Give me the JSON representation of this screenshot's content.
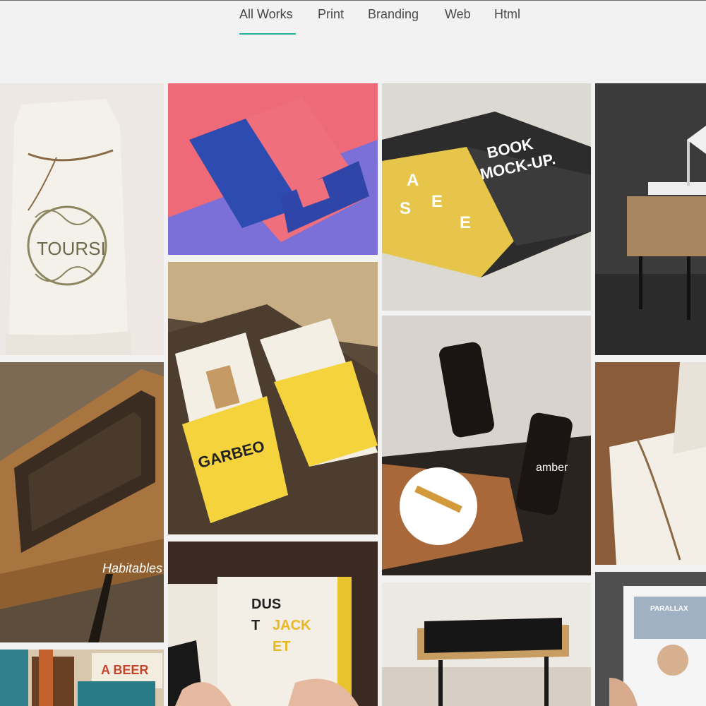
{
  "filters": {
    "all_works": "All Works",
    "print": "Print",
    "branding": "Branding",
    "web": "Web",
    "html": "Html",
    "active": "All Works"
  },
  "mockups": {
    "bag_brand": "TOURSI",
    "book_brand_1": "BOOK",
    "book_brand_2": "MOCK-UP.",
    "book_letters": [
      "A",
      "S",
      "E",
      "E"
    ],
    "garbeo": "GARBEO",
    "amber": "amber",
    "habitables": "Habitables",
    "dust_jacket_1": "DUS",
    "dust_jacket_2": "T",
    "dust_jacket_3": "JACK",
    "dust_jacket_4": "ET",
    "beer": "A BEER",
    "parallax": "PARALLAX"
  },
  "colors": {
    "accent": "#23b49a",
    "background": "#f2f2f2"
  }
}
